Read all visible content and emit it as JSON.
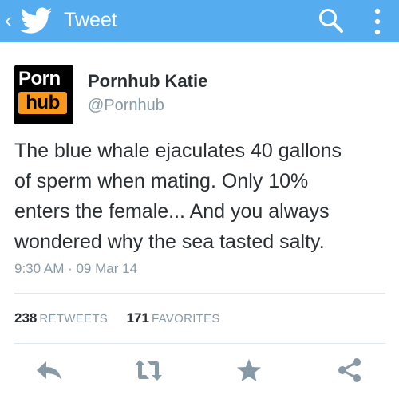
{
  "appbar": {
    "title": "Tweet",
    "back_glyph": "‹",
    "icons": [
      "twitter-bird-icon",
      "search-icon",
      "overflow-menu-icon"
    ],
    "color": "#55acee"
  },
  "author": {
    "avatar_logo_top": "Porn",
    "avatar_logo_bottom": "hub",
    "display_name": "Pornhub Katie",
    "handle": "@Pornhub"
  },
  "tweet": {
    "lines": [
      "The blue whale ejaculates 40 gallons",
      "of sperm when mating. Only 10%",
      "enters the female... And you always",
      "wondered why the sea tasted salty."
    ],
    "timestamp": "9:30 AM · 09 Mar 14"
  },
  "stats": {
    "retweets_count": "238",
    "retweets_label": "RETWEETS",
    "favorites_count": "171",
    "favorites_label": "FAVORITES"
  },
  "actions": [
    "reply-icon",
    "retweet-icon",
    "favorite-icon",
    "share-icon"
  ],
  "colors": {
    "accent": "#55acee",
    "text": "#292f33",
    "muted": "#8899a6",
    "icon": "#8899a6",
    "logo_orange": "#f7971d"
  }
}
